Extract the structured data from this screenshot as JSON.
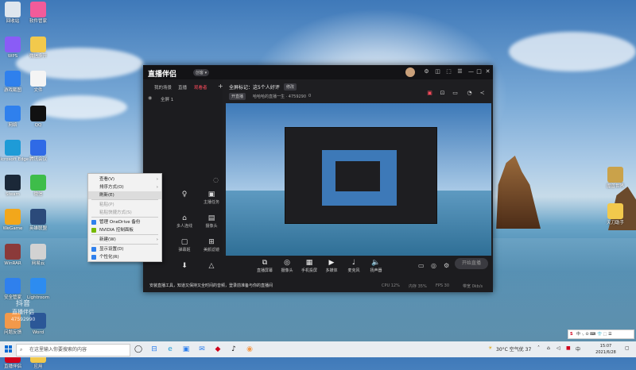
{
  "desktop": {
    "icons_left": [
      {
        "label": "回收站",
        "color": "#dfe6ee"
      },
      {
        "label": "软件管家",
        "color": "#f25b9a"
      },
      {
        "label": "WPS",
        "color": "#8a5cf6"
      },
      {
        "label": "微信多开",
        "color": "#f2c94c"
      },
      {
        "label": "游戏截图",
        "color": "#2f80ed"
      },
      {
        "label": "文件",
        "color": "#f4f4f4"
      },
      {
        "label": "网络",
        "color": "#2f80ed"
      },
      {
        "label": "QQ",
        "color": "#111111"
      },
      {
        "label": "Microsoft Edge",
        "color": "#1e9bd7"
      },
      {
        "label": "腾讯会议",
        "color": "#2f6ae6"
      },
      {
        "label": "Steam",
        "color": "#1b2838"
      },
      {
        "label": "微信",
        "color": "#3ebd4a"
      },
      {
        "label": "WeGame",
        "color": "#f2a71b"
      },
      {
        "label": "英雄联盟",
        "color": "#2b4a7a"
      },
      {
        "label": "WinRAR",
        "color": "#8b3a3a"
      },
      {
        "label": "网易云",
        "color": "#d2d2d2"
      },
      {
        "label": "安全管家",
        "color": "#2f80ed"
      },
      {
        "label": "Lightroom",
        "color": "#2d8cf0"
      },
      {
        "label": "问题反馈",
        "color": "#f2994a"
      },
      {
        "label": "Word",
        "color": "#2b5797"
      },
      {
        "label": "直播伴侣",
        "color": "#d0021b"
      },
      {
        "label": "应用",
        "color": "#f2c94c"
      }
    ],
    "icons_right": [
      {
        "label": "魔兽世界",
        "color": "#caa24a"
      },
      {
        "label": "天刀助手",
        "color": "#f2c94c"
      }
    ],
    "watermark": {
      "line1": "抖音",
      "line2": "直播伴侣",
      "line3": "47592990"
    }
  },
  "app": {
    "logo": "直播伴侣",
    "version": "创客 ▾",
    "window_controls": [
      "⚙",
      "◫",
      "⬚",
      "☰",
      "—",
      "□",
      "✕"
    ],
    "sidebar_tabs": [
      "我的场景",
      "直播",
      "观看者"
    ],
    "scene_label": "全屏 1",
    "stream_title": "全屏标记：这5个人好评",
    "title_tag": "修改",
    "tag1": "开直播",
    "room_info": "哈哈哈的直播一生 · 4759290",
    "viewer_count": "0",
    "sidebar_tools": [
      {
        "label": "",
        "glyph": "♀"
      },
      {
        "label": "主播任务",
        "glyph": "▣"
      },
      {
        "label": "多人连线",
        "glyph": "⌂"
      },
      {
        "label": "摄像头",
        "glyph": "▤"
      },
      {
        "label": "弹幕姬",
        "glyph": "▢"
      },
      {
        "label": "美颜滤镜",
        "glyph": "⊞"
      },
      {
        "label": "",
        "glyph": "⬇"
      },
      {
        "label": "",
        "glyph": "△"
      }
    ],
    "controls": [
      {
        "label": "直播屏幕",
        "glyph": "⧉"
      },
      {
        "label": "摄像头",
        "glyph": "◎"
      },
      {
        "label": "手机投屏",
        "glyph": "▦"
      },
      {
        "label": "多媒体",
        "glyph": "▶"
      },
      {
        "label": "麦克风",
        "glyph": "♩"
      },
      {
        "label": "扬声器",
        "glyph": "🔈"
      }
    ],
    "go_live": "开始直播",
    "notice": "安装直播工具，知道又保持又全时间的音频，登录前准备与你的直播间",
    "status_items": [
      "CPU 12%",
      "内存 35%",
      "FPS 30",
      "带宽 0kb/s"
    ]
  },
  "context_menu": {
    "items": [
      {
        "label": "查看(V)",
        "arrow": true,
        "disabled": false
      },
      {
        "label": "排序方式(O)",
        "arrow": true,
        "disabled": false
      },
      {
        "label": "刷新(E)",
        "arrow": false,
        "disabled": false,
        "hover": true
      },
      {
        "label": "粘贴(P)",
        "arrow": false,
        "disabled": true
      },
      {
        "label": "粘贴快捷方式(S)",
        "arrow": false,
        "disabled": true
      },
      {
        "label": "管理 OneDrive 备份",
        "arrow": false,
        "disabled": false,
        "icon_color": "#2f80ed"
      },
      {
        "label": "NVIDIA 控制面板",
        "arrow": false,
        "disabled": false,
        "icon_color": "#76b900"
      },
      {
        "label": "新建(W)",
        "arrow": true,
        "disabled": false
      },
      {
        "label": "显示设置(D)",
        "arrow": false,
        "disabled": false,
        "icon_color": "#2f80ed"
      },
      {
        "label": "个性化(R)",
        "arrow": false,
        "disabled": false,
        "icon_color": "#2f80ed"
      }
    ]
  },
  "taskbar": {
    "search_placeholder": "在这里输入你要搜索的内容",
    "pinned": [
      {
        "name": "task-view",
        "glyph": "◯"
      },
      {
        "name": "widgets",
        "glyph": "⊟"
      },
      {
        "name": "edge",
        "glyph": "e"
      },
      {
        "name": "store",
        "glyph": "▣"
      },
      {
        "name": "mail",
        "glyph": "✉"
      },
      {
        "name": "app-red",
        "glyph": "◆"
      },
      {
        "name": "tiktok",
        "glyph": "♪"
      },
      {
        "name": "live-companion",
        "glyph": "◉"
      }
    ],
    "weather": "30°C 空气优 37",
    "time": "15:07",
    "date": "2021/6/28",
    "ime_bar": "中 ·, ⊙ ⌨ 👕 ⬚ ☰"
  }
}
